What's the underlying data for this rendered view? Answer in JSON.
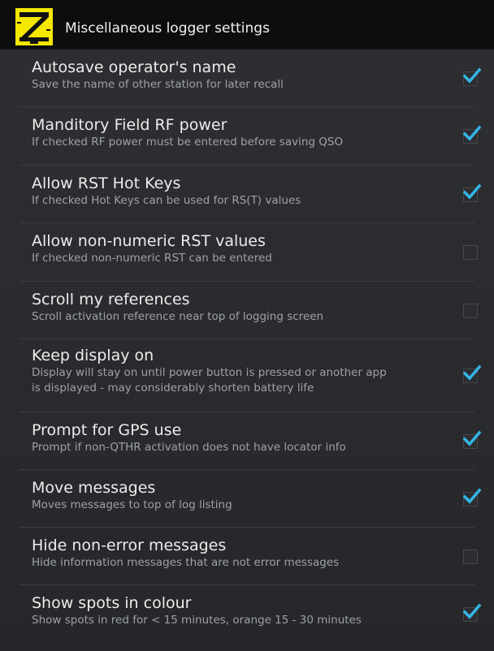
{
  "header": {
    "title": "Miscellaneous logger settings",
    "app_icon": "zulu-log-app-icon",
    "app_icon_color": "#f4e700"
  },
  "colors": {
    "checkbox_check": "#33b5e5",
    "title_text": "#ececec",
    "summary_text": "#9ea1a5"
  },
  "settings": [
    {
      "title": "Autosave operator's name",
      "summary": "Save the name of other station for later recall",
      "checked": true
    },
    {
      "title": "Manditory Field RF power",
      "summary": "If checked RF power must be entered before saving QSO",
      "checked": true
    },
    {
      "title": "Allow RST Hot Keys",
      "summary": "If checked Hot Keys can be used for RS(T) values",
      "checked": true
    },
    {
      "title": "Allow non-numeric RST values",
      "summary": "If checked non-numeric RST can be entered",
      "checked": false
    },
    {
      "title": "Scroll my references",
      "summary": "Scroll activation reference near top of logging screen",
      "checked": false
    },
    {
      "title": "Keep display on",
      "summary": "Display will stay on until power button is pressed or another app",
      "summary2": "is displayed - may considerably shorten battery life",
      "checked": true
    },
    {
      "title": "Prompt for GPS use",
      "summary": "Prompt if non-QTHR activation does not have locator info",
      "checked": true
    },
    {
      "title": "Move messages",
      "summary": "Moves messages to top of log listing",
      "checked": true
    },
    {
      "title": "Hide non-error messages",
      "summary": "Hide information messages that are not error messages",
      "checked": false
    },
    {
      "title": "Show spots in colour",
      "summary": "Show spots in red for < 15 minutes, orange 15 - 30 minutes",
      "checked": true
    }
  ]
}
